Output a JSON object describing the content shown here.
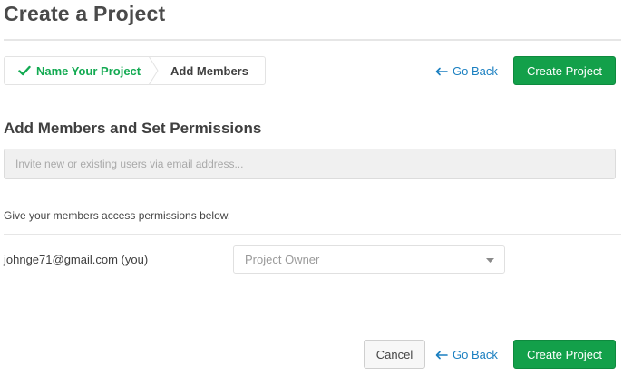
{
  "header": {
    "title": "Create a Project"
  },
  "stepper": {
    "steps": [
      {
        "label": "Name Your Project",
        "status": "completed",
        "icon": "check-icon"
      },
      {
        "label": "Add Members",
        "status": "current"
      }
    ]
  },
  "actions": {
    "go_back_label": "Go Back",
    "create_label": "Create Project",
    "cancel_label": "Cancel"
  },
  "members_section": {
    "heading": "Add Members and Set Permissions",
    "invite_placeholder": "Invite new or existing users via email address...",
    "helper_text": "Give your members access permissions below.",
    "members": [
      {
        "email": "johnge71@gmail.com (you)",
        "role": "Project Owner"
      }
    ]
  },
  "colors": {
    "primary_green": "#13a04a",
    "link_blue": "#1a7fc0",
    "completed_step_green": "#13aa52"
  }
}
